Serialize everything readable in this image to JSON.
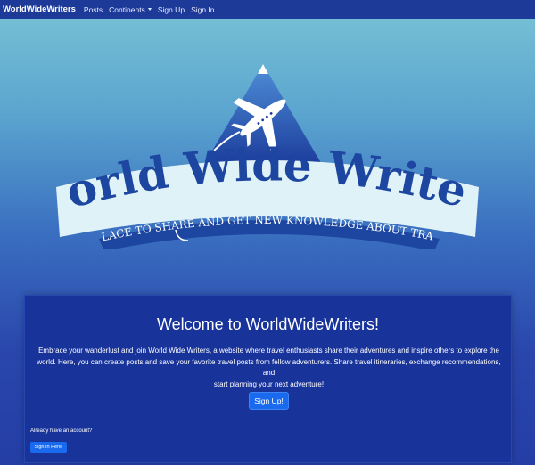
{
  "navbar": {
    "brand": "WorldWideWriters",
    "links": [
      "Posts",
      "Continents",
      "Sign Up",
      "Sign In"
    ]
  },
  "logo": {
    "title": "World Wide Writers",
    "tagline": "A PLACE TO SHARE AND GET NEW KNOWLEDGE ABOUT TRAVEL"
  },
  "welcome": {
    "heading": "Welcome to WorldWideWriters!",
    "description_lines": [
      "Embrace your wanderlust and join World Wide Writers, a website where travel enthusiasts share their adventures and inspire others to explore the",
      "world. Here, you can create posts and save your favorite travel posts from fellow adventurers. Share travel itineraries, exchange recommendations, and",
      "start planning your next adventure!"
    ],
    "signup_button": "Sign Up!",
    "already_text": "Already have an account?",
    "signin_button": "Sign In Here!"
  },
  "colors": {
    "navbar": "#1e3a98",
    "panel": "#18339a",
    "button": "#1a6af0",
    "logo_banner": "#dff2f7",
    "logo_text": "#1c46a0"
  }
}
